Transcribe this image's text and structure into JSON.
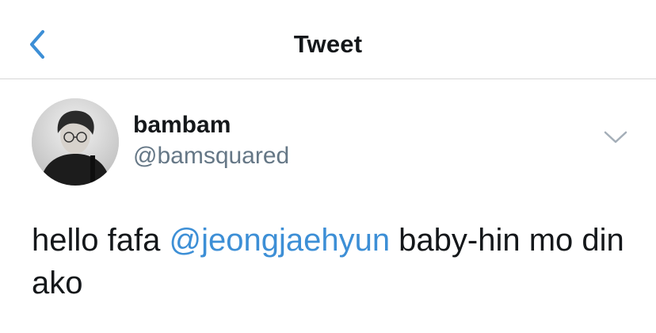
{
  "header": {
    "title": "Tweet",
    "back_icon": "chevron-left-icon"
  },
  "colors": {
    "accent": "#3d8fd6",
    "text": "#14171a",
    "secondary_text": "#657786",
    "divider": "#d6d6d6"
  },
  "tweet": {
    "author": {
      "display_name": "bambam",
      "handle": "@bamsquared",
      "avatar_icon": "avatar-photo"
    },
    "menu_icon": "chevron-down-icon",
    "text_before": "hello fafa ",
    "mention": "@jeongjaehyun",
    "text_after": " baby-hin mo din ako"
  }
}
